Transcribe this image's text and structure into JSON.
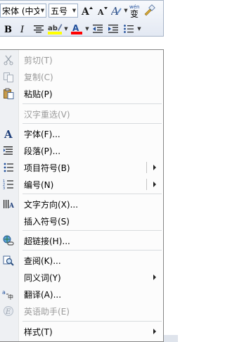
{
  "mini_toolbar": {
    "font_name": "宋体 (中文",
    "font_size": "五号",
    "wen_label": "wén",
    "wen_char": "变",
    "font_color_letter": "A",
    "highlight_letters": "ab",
    "colors": {
      "highlight": "#ffff00",
      "font_color": "#ff0000",
      "accent": "#1f4e9b"
    }
  },
  "context_menu": {
    "items": [
      {
        "label": "剪切(T)",
        "icon": "scissors-icon",
        "disabled": true
      },
      {
        "label": "复制(C)",
        "icon": "copy-icon",
        "disabled": true
      },
      {
        "label": "粘贴(P)",
        "icon": "paste-icon",
        "disabled": false
      },
      {
        "label": "汉字重选(V)",
        "icon": "",
        "disabled": true
      },
      {
        "label": "字体(F)...",
        "icon": "font-icon",
        "disabled": false
      },
      {
        "label": "段落(P)...",
        "icon": "paragraph-icon",
        "disabled": false
      },
      {
        "label": "项目符号(B)",
        "icon": "bullets-icon",
        "disabled": false,
        "submenu": true
      },
      {
        "label": "编号(N)",
        "icon": "numbering-icon",
        "disabled": false,
        "submenu": true
      },
      {
        "label": "文字方向(X)...",
        "icon": "text-direction-icon",
        "disabled": false
      },
      {
        "label": "插入符号(S)",
        "icon": "",
        "disabled": false
      },
      {
        "label": "超链接(H)...",
        "icon": "hyperlink-icon",
        "disabled": false
      },
      {
        "label": "查阅(K)...",
        "icon": "lookup-icon",
        "disabled": false
      },
      {
        "label": "同义词(Y)",
        "icon": "",
        "disabled": false,
        "submenu": true
      },
      {
        "label": "翻译(A)...",
        "icon": "translate-icon",
        "disabled": false
      },
      {
        "label": "英语助手(E)",
        "icon": "english-assistant-icon",
        "disabled": true
      },
      {
        "label": "样式(T)",
        "icon": "",
        "disabled": false,
        "submenu": true
      }
    ]
  }
}
